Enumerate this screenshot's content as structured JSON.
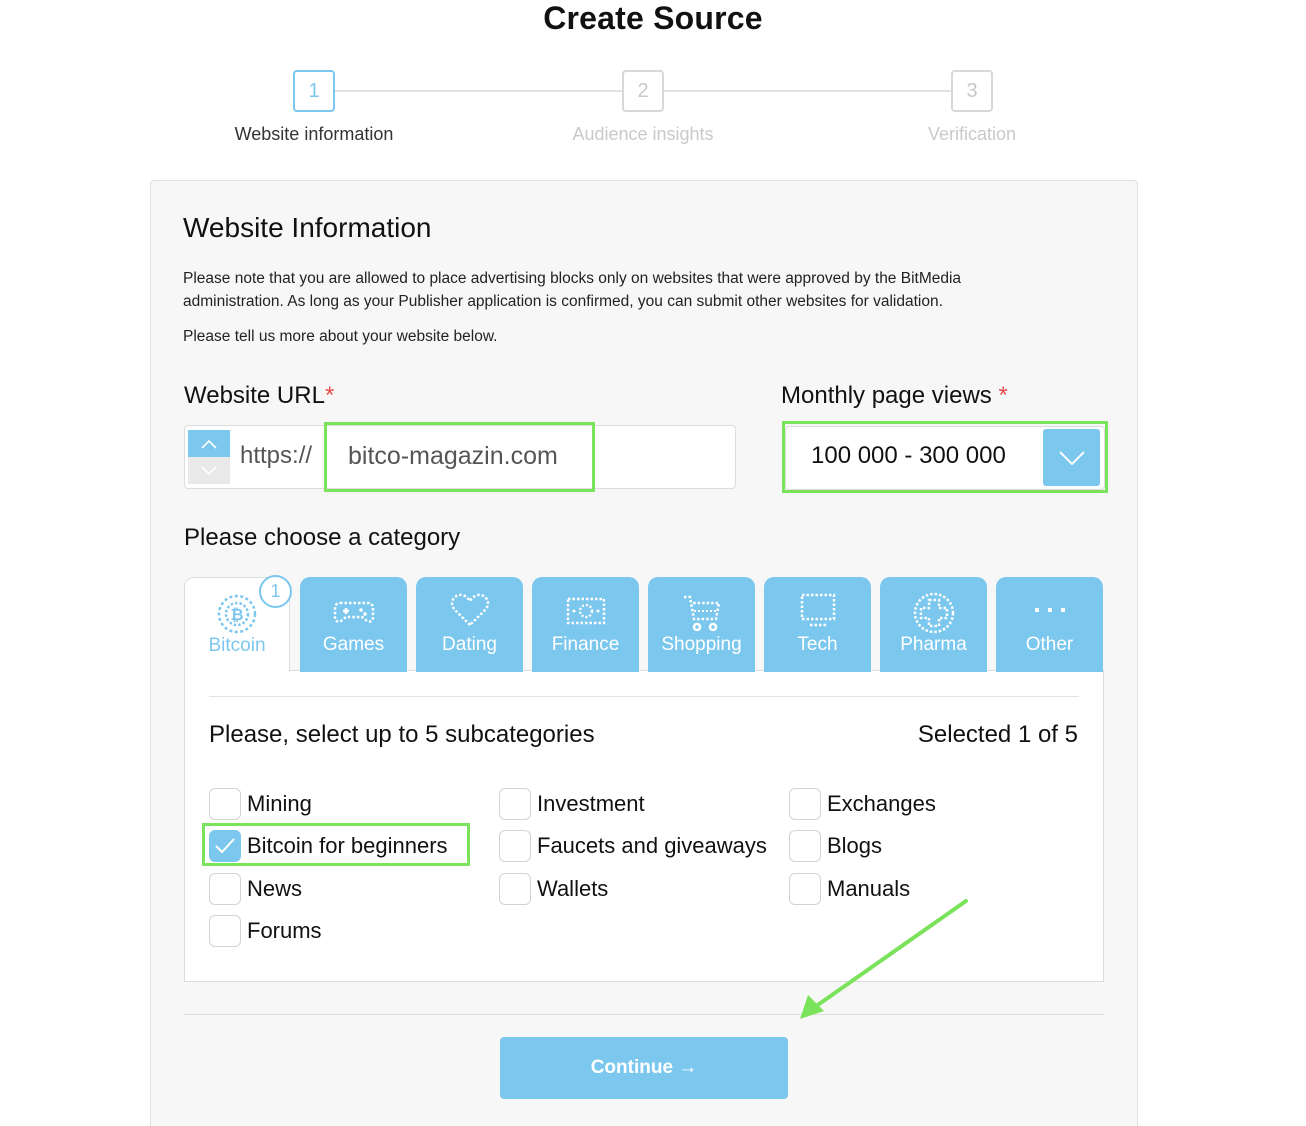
{
  "page_title": "Create Source",
  "stepper": {
    "steps": [
      {
        "number": "1",
        "label": "Website information",
        "active": true
      },
      {
        "number": "2",
        "label": "Audience insights",
        "active": false
      },
      {
        "number": "3",
        "label": "Verification",
        "active": false
      }
    ]
  },
  "form": {
    "section_title": "Website Information",
    "note_line1": "Please note that you are allowed to place advertising blocks only on websites that were approved by the BitMedia",
    "note_line2": "administration. As long as your Publisher application is confirmed, you can submit other websites for validation.",
    "note_line3": "Please tell us more about your website below.",
    "url_label": "Website URL",
    "required_mark": "*",
    "protocol": "https://",
    "url_value": "bitco-magazin.com",
    "pageviews_label": "Monthly page views",
    "pageviews_value": "100 000 - 300 000",
    "category_label": "Please choose a category"
  },
  "tabs": [
    {
      "label": "Bitcoin",
      "icon": "bitcoin-icon",
      "active": true
    },
    {
      "label": "Games",
      "icon": "gamepad-icon",
      "active": false
    },
    {
      "label": "Dating",
      "icon": "heart-icon",
      "active": false
    },
    {
      "label": "Finance",
      "icon": "banknote-icon",
      "active": false
    },
    {
      "label": "Shopping",
      "icon": "cart-icon",
      "active": false
    },
    {
      "label": "Tech",
      "icon": "monitor-icon",
      "active": false
    },
    {
      "label": "Pharma",
      "icon": "medical-cross-icon",
      "active": false
    },
    {
      "label": "Other",
      "icon": "dots-icon",
      "active": false
    }
  ],
  "tab_badge": "1",
  "subcategories": {
    "title": "Please, select up to 5 subcategories",
    "count_text": "Selected 1 of 5",
    "items": [
      {
        "label": "Mining",
        "checked": false
      },
      {
        "label": "Bitcoin for beginners",
        "checked": true
      },
      {
        "label": "News",
        "checked": false
      },
      {
        "label": "Forums",
        "checked": false
      },
      {
        "label": "Investment",
        "checked": false
      },
      {
        "label": "Faucets and giveaways",
        "checked": false
      },
      {
        "label": "Wallets",
        "checked": false
      },
      {
        "label": "Exchanges",
        "checked": false
      },
      {
        "label": "Blogs",
        "checked": false
      },
      {
        "label": "Manuals",
        "checked": false
      }
    ]
  },
  "continue_label": "Continue →",
  "colors": {
    "accent": "#7cc7ee",
    "highlight": "#7be35b",
    "required": "#e84b4b"
  }
}
